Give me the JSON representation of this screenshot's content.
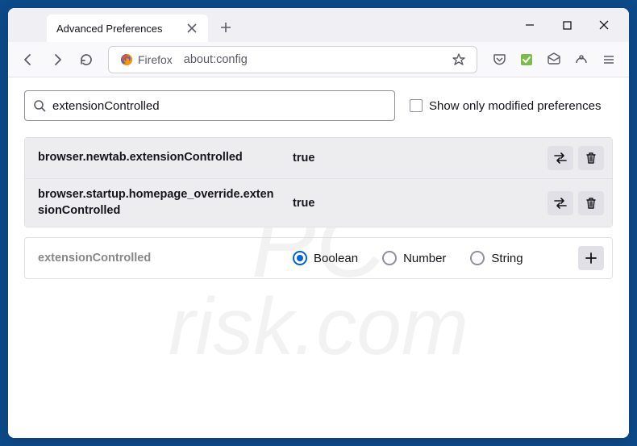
{
  "window": {
    "tab_title": "Advanced Preferences",
    "identity_label": "Firefox",
    "url": "about:config"
  },
  "search": {
    "value": "extensionControlled",
    "checkbox_label": "Show only modified preferences"
  },
  "prefs": [
    {
      "name": "browser.newtab.extensionControlled",
      "value": "true"
    },
    {
      "name": "browser.startup.homepage_override.extensionControlled",
      "value": "true"
    }
  ],
  "addrow": {
    "name": "extensionControlled",
    "options": [
      "Boolean",
      "Number",
      "String"
    ],
    "selected": "Boolean"
  },
  "watermark": {
    "line1": "PC",
    "line2": "risk.com"
  }
}
